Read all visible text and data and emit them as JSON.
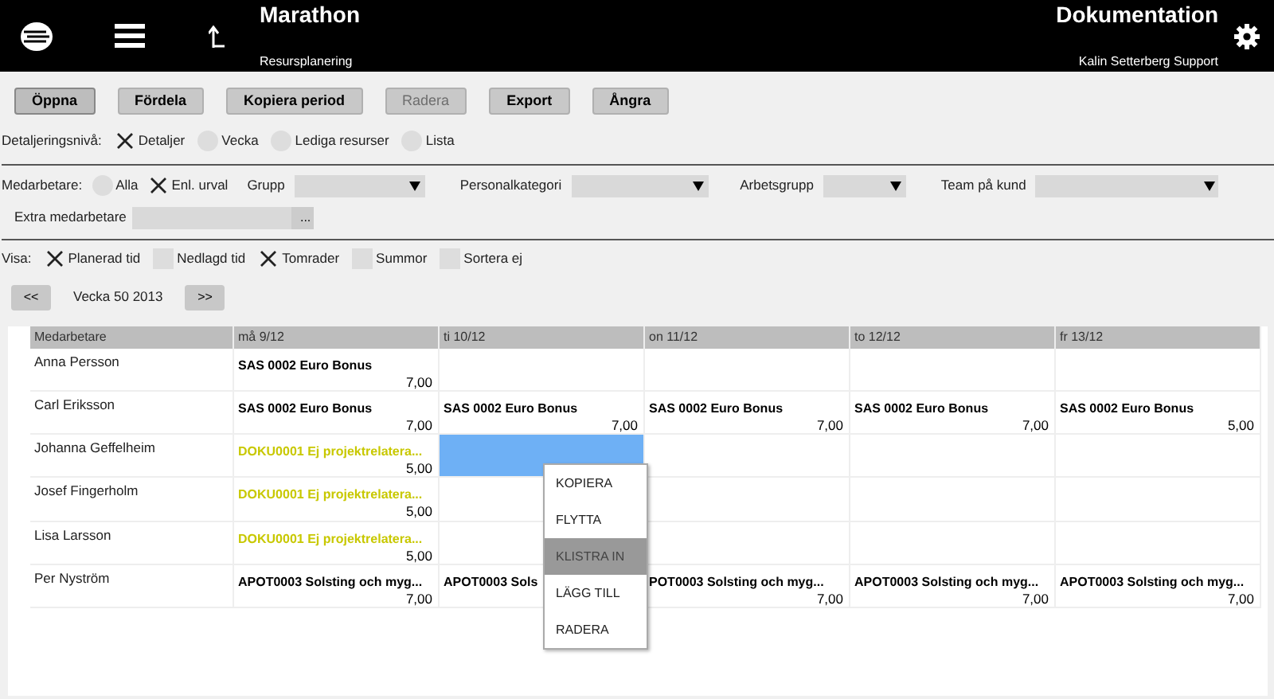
{
  "header": {
    "title": "Marathon",
    "subtitle": "Resursplanering",
    "right_title": "Dokumentation",
    "right_subtitle": "Kalin Setterberg Support"
  },
  "toolbar": [
    {
      "label": "Öppna",
      "disabled": false,
      "selected": true
    },
    {
      "label": "Fördela",
      "disabled": false,
      "selected": false
    },
    {
      "label": "Kopiera period",
      "disabled": false,
      "selected": false
    },
    {
      "label": "Radera",
      "disabled": true,
      "selected": false
    },
    {
      "label": "Export",
      "disabled": false,
      "selected": false
    },
    {
      "label": "Ångra",
      "disabled": false,
      "selected": false
    }
  ],
  "detail_level": {
    "label": "Detaljeringsnivå:",
    "options": [
      {
        "label": "Detaljer",
        "selected": true
      },
      {
        "label": "Vecka",
        "selected": false
      },
      {
        "label": "Lediga resurser",
        "selected": false
      },
      {
        "label": "Lista",
        "selected": false
      }
    ]
  },
  "employees": {
    "label": "Medarbetare:",
    "options": [
      {
        "label": "Alla",
        "selected": false
      },
      {
        "label": "Enl. urval",
        "selected": true
      }
    ]
  },
  "filters": [
    {
      "label": "Grupp"
    },
    {
      "label": "Personalkategori"
    },
    {
      "label": "Arbetsgrupp"
    },
    {
      "label": "Team på kund"
    }
  ],
  "extra_employees": {
    "label": "Extra medarbetare",
    "button": "..."
  },
  "show": {
    "label": "Visa:",
    "options": [
      {
        "label": "Planerad tid",
        "checked": true
      },
      {
        "label": "Nedlagd tid",
        "checked": false
      },
      {
        "label": "Tomrader",
        "checked": true
      },
      {
        "label": "Summor",
        "checked": false
      },
      {
        "label": "Sortera ej",
        "checked": false
      }
    ]
  },
  "week_nav": {
    "prev": "<<",
    "label": "Vecka 50 2013",
    "next": ">>"
  },
  "table": {
    "columns": [
      "Medarbetare",
      "må 9/12",
      "ti 10/12",
      "on 11/12",
      "to 12/12",
      "fr 13/12"
    ],
    "rows": [
      {
        "cells": [
          {
            "kind": "name",
            "text": "Anna Persson"
          },
          {
            "text": "SAS 0002 Euro Bonus",
            "hours": "7,00",
            "color": "#000000",
            "selected": false
          },
          {
            "selected": false
          },
          {
            "selected": false
          },
          {
            "selected": false
          },
          {
            "selected": false
          }
        ]
      },
      {
        "cells": [
          {
            "kind": "name",
            "text": "Carl Eriksson"
          },
          {
            "text": "SAS 0002 Euro Bonus",
            "hours": "7,00",
            "color": "#000000",
            "selected": false
          },
          {
            "text": "SAS 0002 Euro Bonus",
            "hours": "7,00",
            "color": "#000000",
            "selected": false
          },
          {
            "text": "SAS 0002 Euro Bonus",
            "hours": "7,00",
            "color": "#000000",
            "selected": false
          },
          {
            "text": "SAS 0002 Euro Bonus",
            "hours": "7,00",
            "color": "#000000",
            "selected": false
          },
          {
            "text": "SAS 0002 Euro Bonus",
            "hours": "5,00",
            "color": "#000000",
            "selected": false
          }
        ]
      },
      {
        "cells": [
          {
            "kind": "name",
            "text": "Johanna Geffelheim"
          },
          {
            "text": "DOKU0001 Ej projektrelatera...",
            "hours": "5,00",
            "color": "#c8c800",
            "selected": false
          },
          {
            "selected": true
          },
          {
            "selected": false
          },
          {
            "selected": false
          },
          {
            "selected": false
          }
        ]
      },
      {
        "cells": [
          {
            "kind": "name",
            "text": "Josef Fingerholm"
          },
          {
            "text": "DOKU0001 Ej projektrelatera...",
            "hours": "5,00",
            "color": "#c8c800",
            "selected": false
          },
          {
            "selected": false
          },
          {
            "selected": false
          },
          {
            "selected": false
          },
          {
            "selected": false
          }
        ]
      },
      {
        "cells": [
          {
            "kind": "name",
            "text": "Lisa Larsson"
          },
          {
            "text": "DOKU0001 Ej projektrelatera...",
            "hours": "5,00",
            "color": "#c8c800",
            "selected": false
          },
          {
            "selected": false
          },
          {
            "selected": false
          },
          {
            "selected": false
          },
          {
            "selected": false
          }
        ]
      },
      {
        "cells": [
          {
            "kind": "name",
            "text": "Per Nyström"
          },
          {
            "text": "APOT0003 Solsting och myg...",
            "hours": "7,00",
            "color": "#000000",
            "selected": false
          },
          {
            "text": "APOT0003 Sols",
            "color": "#000000",
            "selected": false
          },
          {
            "text": "POT0003 Solsting och myg...",
            "hours": "7,00",
            "color": "#000000",
            "selected": false
          },
          {
            "text": "APOT0003 Solsting och myg...",
            "hours": "7,00",
            "color": "#000000",
            "selected": false
          },
          {
            "text": "APOT0003 Solsting och myg...",
            "hours": "7,00",
            "color": "#000000",
            "selected": false
          }
        ]
      }
    ]
  },
  "context_menu": [
    {
      "label": "KOPIERA",
      "selected": false
    },
    {
      "label": "FLYTTA",
      "selected": false
    },
    {
      "label": "KLISTRA IN",
      "selected": true
    },
    {
      "label": "LÄGG TILL",
      "selected": false
    },
    {
      "label": "RADERA",
      "selected": false
    }
  ]
}
